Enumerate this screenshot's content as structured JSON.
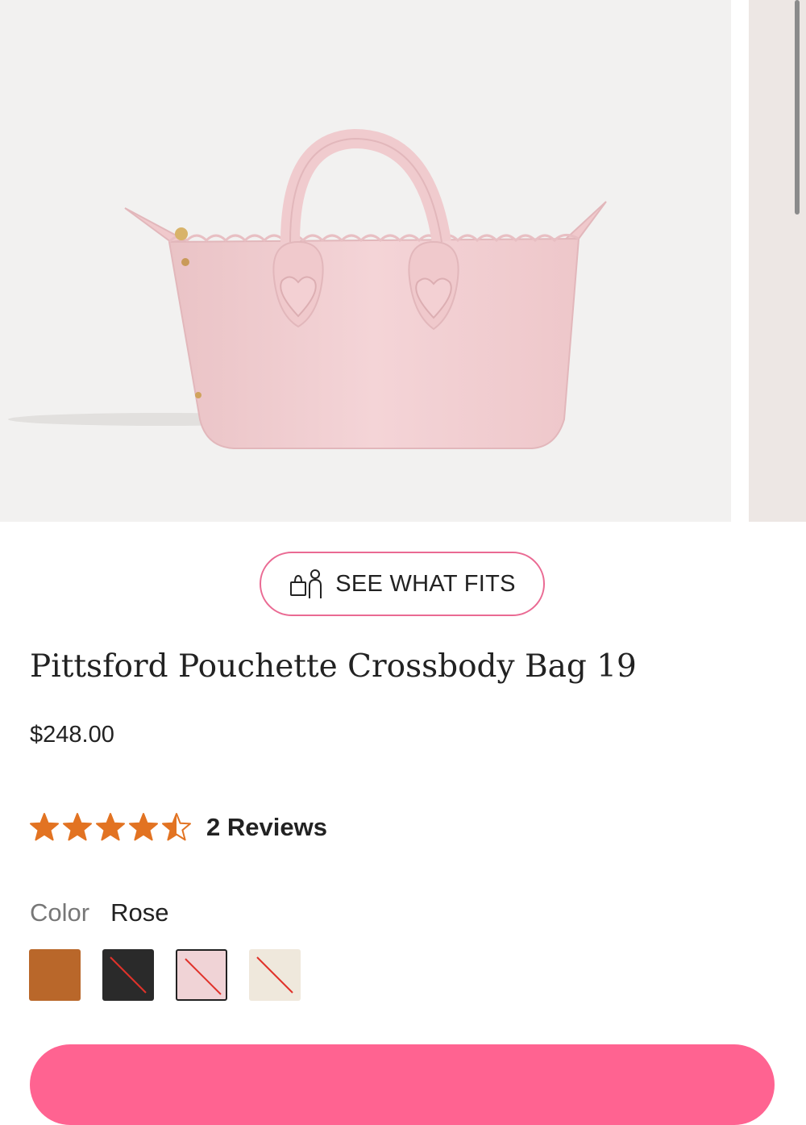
{
  "gallery": {
    "main_image_alt": "Pink leather mini tote with scalloped trim and heart handle tabs",
    "next_image_alt": "next product image"
  },
  "fits_button": {
    "label": "SEE WHAT FITS"
  },
  "product": {
    "title": "Pittsford Pouchette Crossbody Bag 19",
    "price": "$248.00"
  },
  "rating": {
    "value": 4.5,
    "max": 5,
    "reviews_label": "2 Reviews",
    "star_color": "#e27322"
  },
  "color": {
    "label": "Color",
    "selected": "Rose",
    "swatches": [
      {
        "name": "Cognac",
        "color": "#b9672a",
        "available": true,
        "selected": false
      },
      {
        "name": "Black",
        "color": "#2a2a2a",
        "available": false,
        "selected": false
      },
      {
        "name": "Rose",
        "color": "#f0d3d6",
        "available": false,
        "selected": true
      },
      {
        "name": "Cream",
        "color": "#efe8dc",
        "available": false,
        "selected": false
      }
    ]
  },
  "colors": {
    "accent": "#ff6391",
    "button_border": "#ea6a93",
    "unavailable_slash": "#e0322a"
  }
}
